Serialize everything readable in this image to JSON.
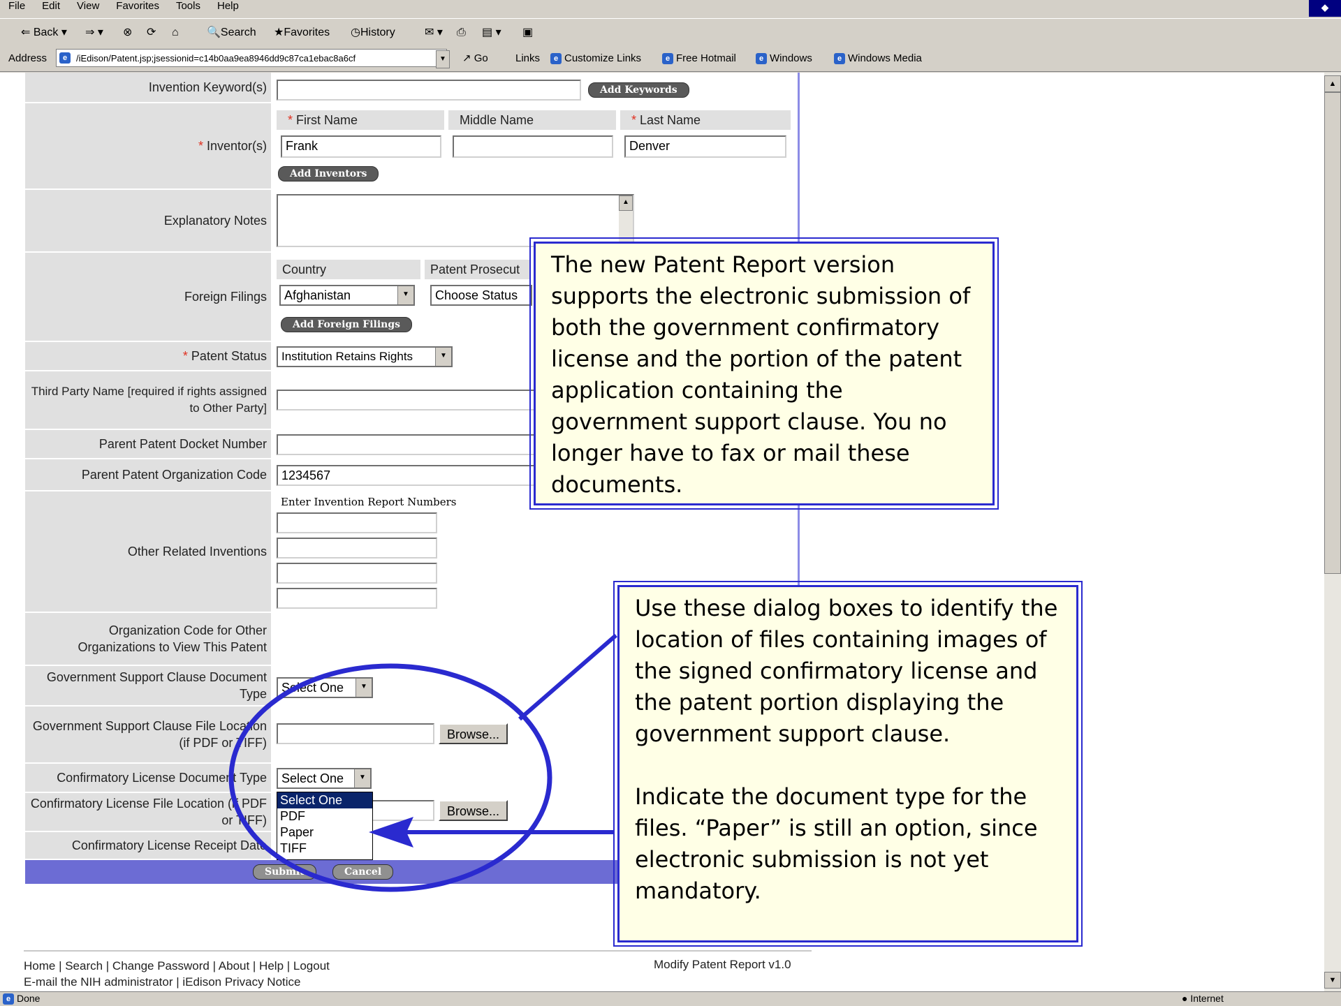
{
  "window": {
    "menu": [
      "File",
      "Edit",
      "View",
      "Favorites",
      "Tools",
      "Help"
    ],
    "toolbar": {
      "back": "Back",
      "search": "Search",
      "favorites": "Favorites",
      "history": "History"
    },
    "address_label": "Address",
    "address_value": "/iEdison/Patent.jsp;jsessionid=c14b0aa9ea8946dd9c87ca1ebac8a6cf",
    "go_label": "Go",
    "links_label": "Links",
    "links": [
      "Customize Links",
      "Free Hotmail",
      "Windows",
      "Windows Media"
    ],
    "status_left": "Done",
    "status_right": "Internet"
  },
  "form": {
    "keywords": {
      "label": "Invention Keyword(s)",
      "value": "",
      "button": "Add Keywords"
    },
    "inventors": {
      "label": "Inventor(s)",
      "col_first": "First Name",
      "col_middle": "Middle Name",
      "col_last": "Last Name",
      "first": "Frank",
      "middle": "",
      "last": "Denver",
      "button": "Add Inventors"
    },
    "notes": {
      "label": "Explanatory Notes"
    },
    "foreign": {
      "label": "Foreign Filings",
      "col_country": "Country",
      "col_status": "Patent Prosecut",
      "country": "Afghanistan",
      "status": "Choose Status",
      "button": "Add Foreign Filings"
    },
    "patent_status": {
      "label": "Patent Status",
      "value": "Institution Retains Rights"
    },
    "third_party": {
      "label": "Third Party Name [required if rights assigned to Other Party]",
      "value": ""
    },
    "parent_docket": {
      "label": "Parent Patent Docket Number",
      "value": ""
    },
    "parent_org": {
      "label": "Parent Patent Organization Code",
      "value": "1234567"
    },
    "related": {
      "label": "Other Related Inventions",
      "hint": "Enter Invention Report Numbers"
    },
    "org_codes": {
      "label": "Organization Code for Other Organizations to View This Patent"
    },
    "gov_doc_type": {
      "label": "Government Support Clause Document Type",
      "value": "Select One"
    },
    "gov_file": {
      "label": "Government Support Clause File Location (if PDF or TIFF)",
      "value": "",
      "button": "Browse..."
    },
    "conf_doc_type": {
      "label": "Confirmatory License Document Type",
      "value": "Select One"
    },
    "conf_file": {
      "label": "Confirmatory License File Location (if PDF or TIFF)",
      "button": "Browse..."
    },
    "conf_receipt": {
      "label": "Confirmatory License Receipt Date"
    },
    "dropdown_options": [
      "Select One",
      "PDF",
      "Paper",
      "TIFF"
    ],
    "submit": "Submit",
    "cancel": "Cancel"
  },
  "footer": {
    "line1": "Home | Search | Change Password | About | Help | Logout",
    "line2": "E-mail the NIH administrator | iEdison Privacy Notice",
    "version": "Modify Patent Report v1.0"
  },
  "callouts": {
    "top": "The new Patent Report version supports the electronic submission of both the government confirmatory license and the portion of the patent application containing the government support clause.  You no longer have to fax or mail these documents.",
    "bottom_p1": "Use these dialog boxes to identify the location of files containing images of the signed confirmatory license and the patent portion displaying the government support clause.",
    "bottom_p2": "Indicate the document type for the files. “Paper” is still an option, since electronic submission is not yet mandatory."
  },
  "colors": {
    "accent": "#2a2acf",
    "callout_bg": "#ffffe6",
    "submit_bar": "#6c6cd4"
  }
}
